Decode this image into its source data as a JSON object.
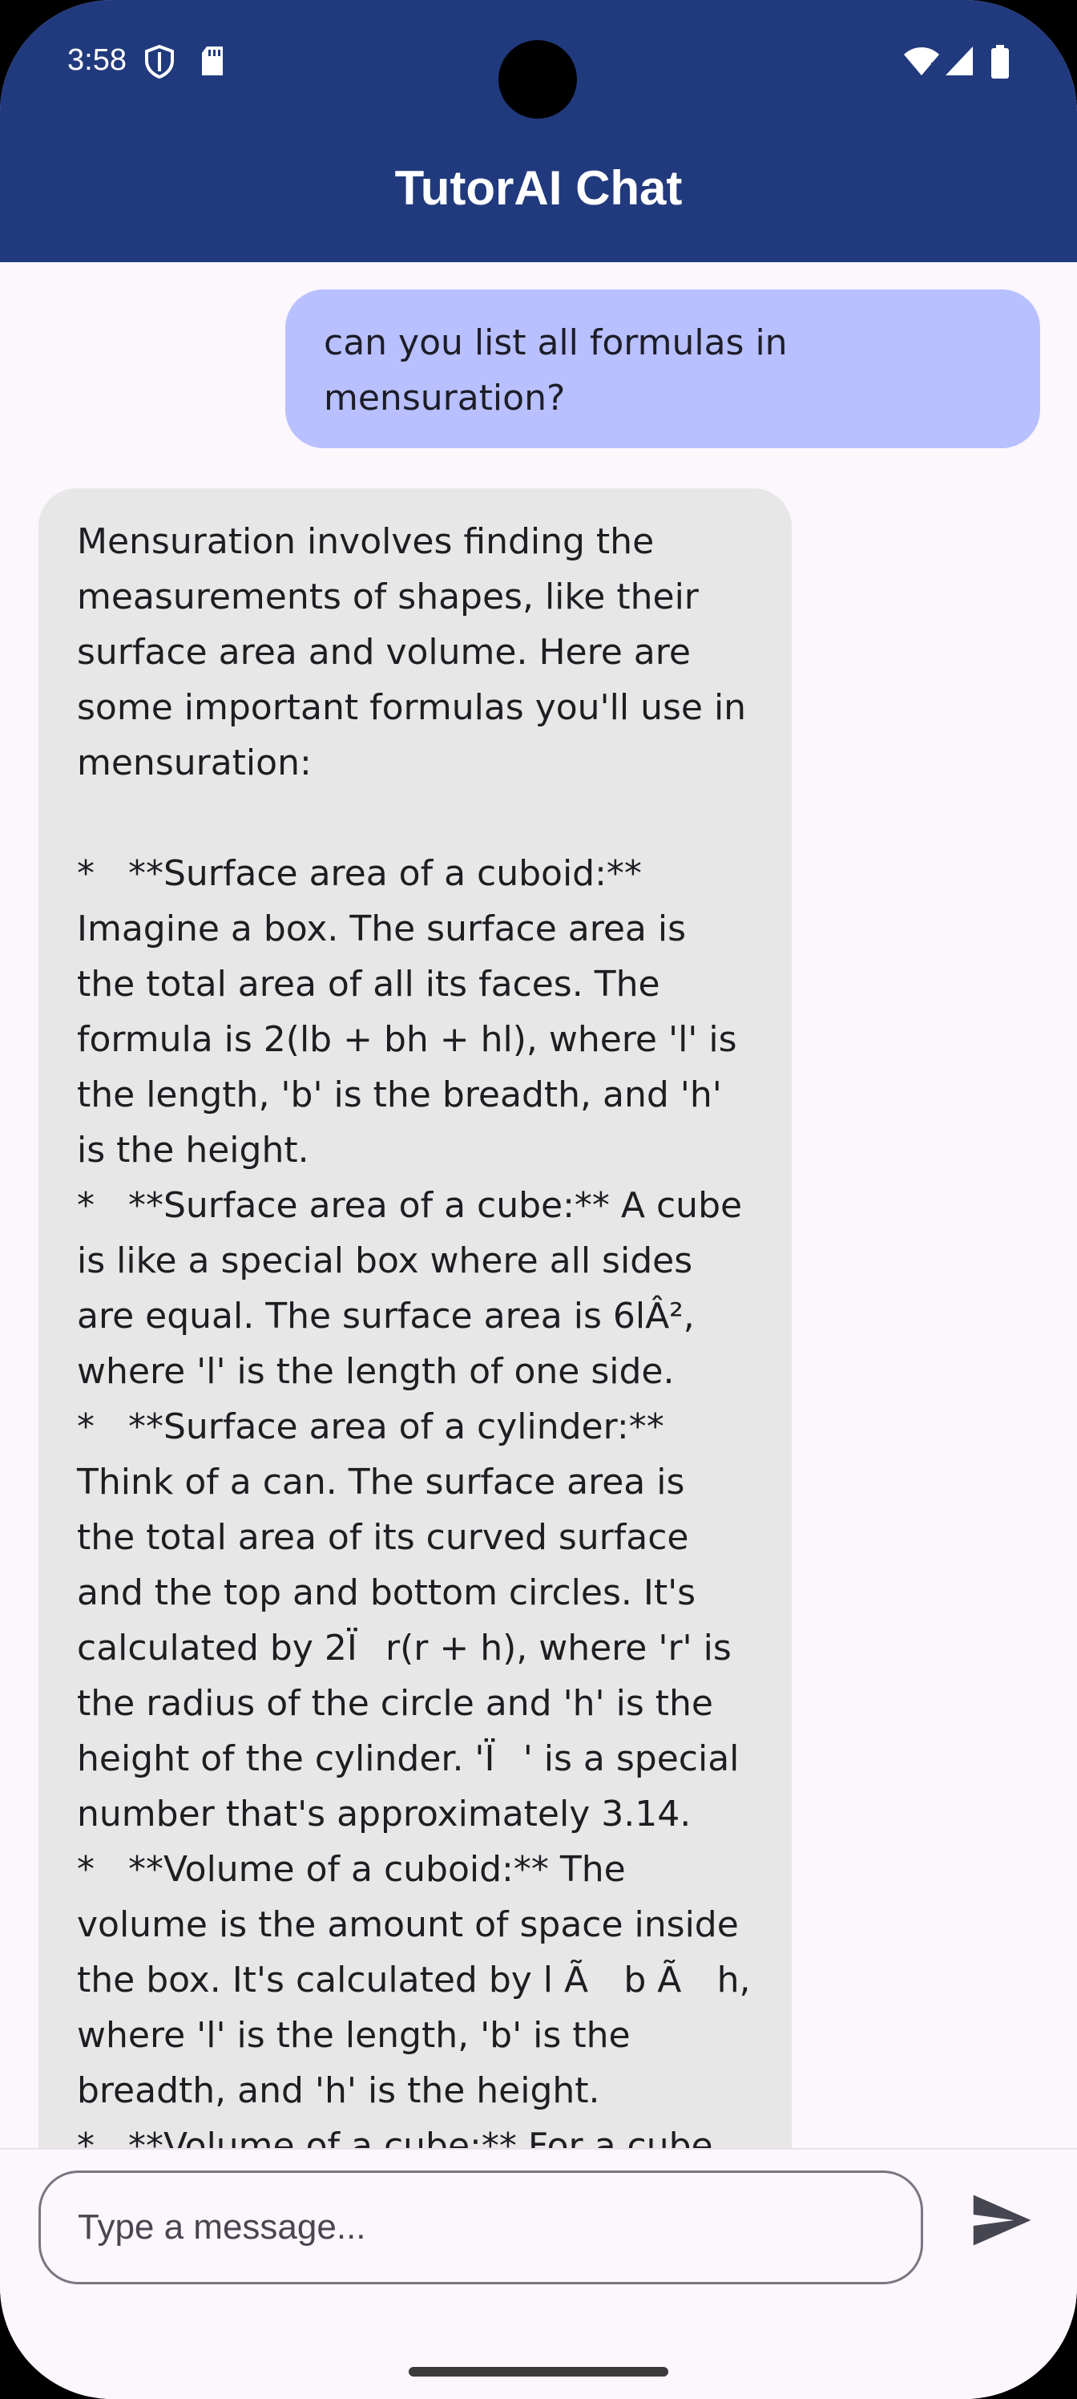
{
  "status_bar": {
    "time": "3:58",
    "icons": [
      "shield-icon",
      "sd-card-icon",
      "wifi-icon",
      "signal-icon",
      "battery-icon"
    ]
  },
  "app": {
    "title": "TutorAI Chat",
    "colors": {
      "app_bar": "#213A7D",
      "user_bubble": "#B8C0FF",
      "bot_bubble": "#E7E7E7",
      "background": "#FCF6FD"
    }
  },
  "messages": [
    {
      "role": "user",
      "text": "can you list all formulas in mensuration?"
    },
    {
      "role": "assistant",
      "text": "Mensuration involves finding the measurements of shapes, like their surface area and volume. Here are some important formulas you'll use in mensuration:\n\n*   **Surface area of a cuboid:** Imagine a box. The surface area is the total area of all its faces. The formula is 2(lb + bh + hl), where 'l' is the length, 'b' is the breadth, and 'h' is the height.\n*   **Surface area of a cube:** A cube is like a special box where all sides are equal. The surface area is 6lÂ², where 'l' is the length of one side.\n*   **Surface area of a cylinder:** Think of a can. The surface area is the total area of its curved surface and the top and bottom circles. It's calculated by 2Ïr(r + h), where 'r' is the radius of the circle and 'h' is the height of the cylinder. 'Ï' is a special number that's approximately 3.14.\n*   **Volume of a cuboid:** The volume is the amount of space inside the box. It's calculated by l Ã b Ã h, where 'l' is the length, 'b' is the breadth, and 'h' is the height.\n*   **Volume of a cube:** For a cube"
    }
  ],
  "composer": {
    "placeholder": "Type a message...",
    "send_icon": "send-icon"
  }
}
